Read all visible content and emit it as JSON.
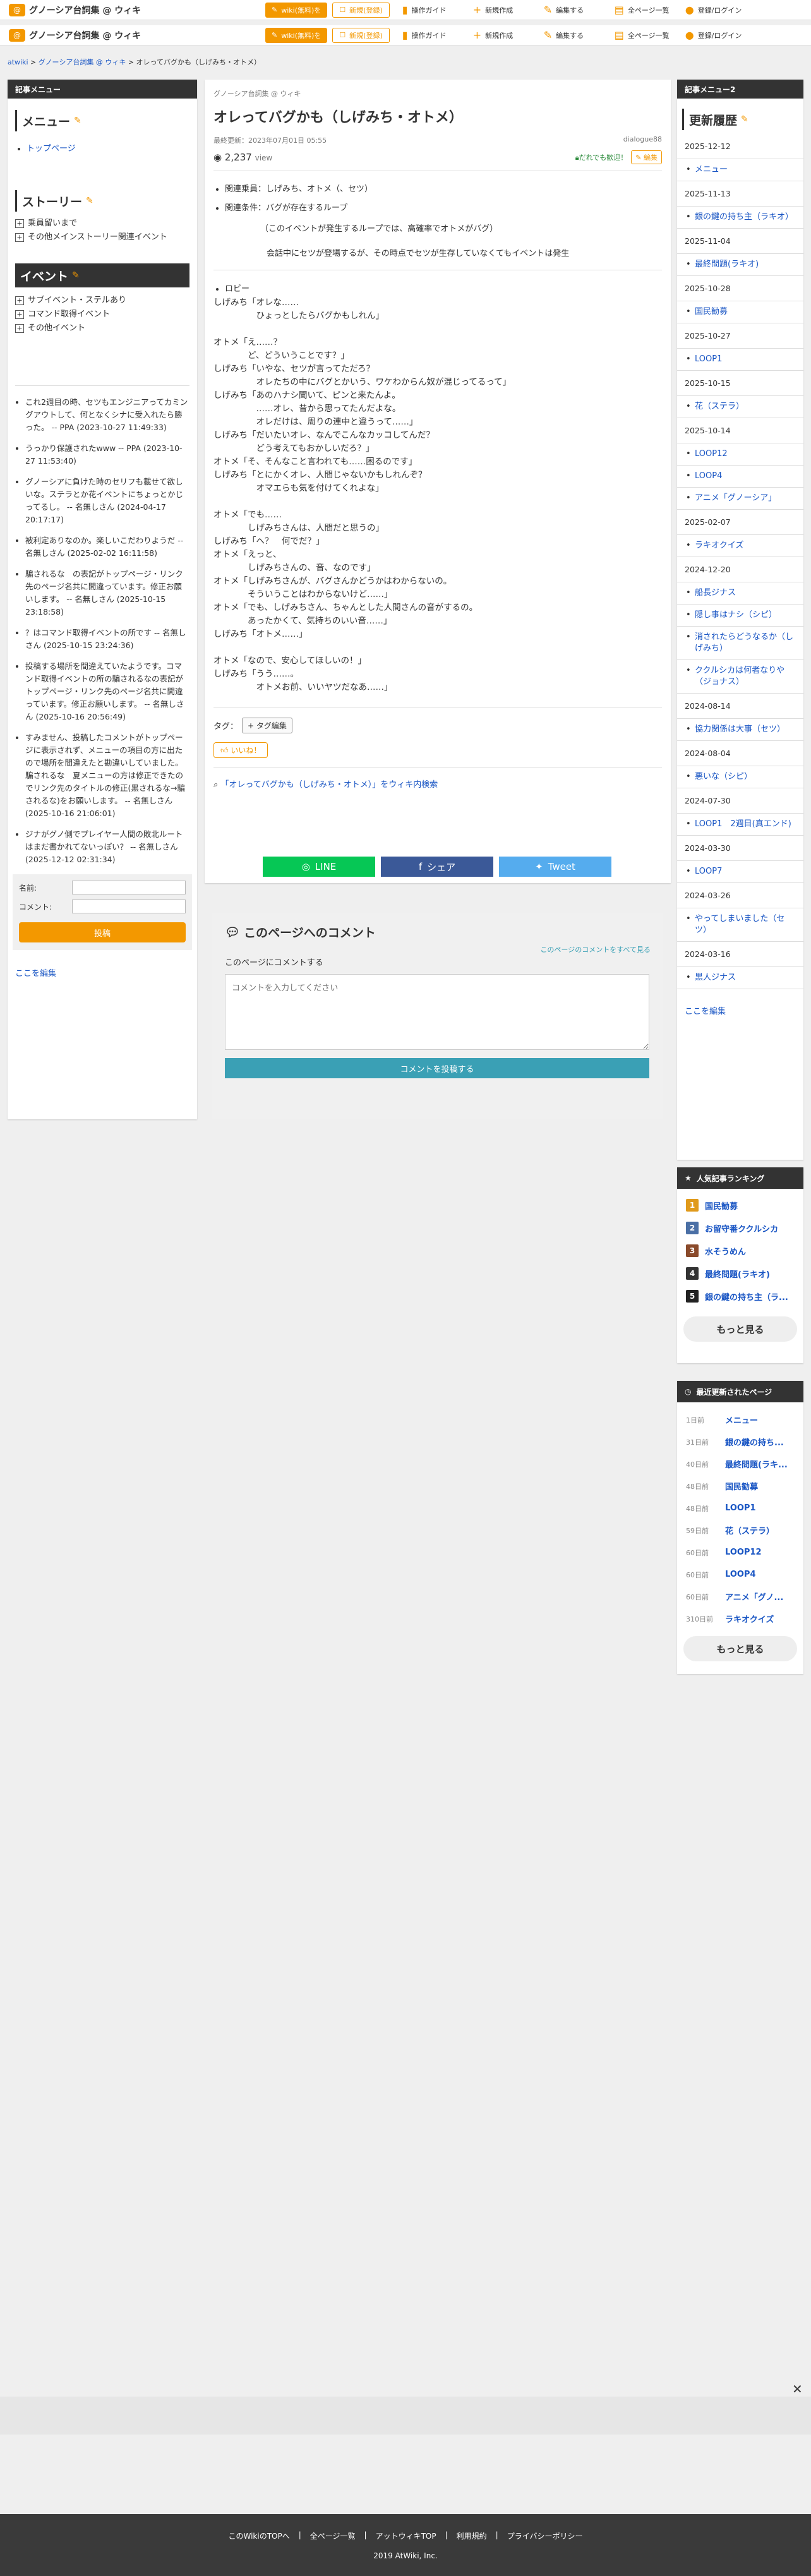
{
  "header": {
    "site_title": "グノーシア台詞集 @ ウィキ",
    "btn_wiki_create": "wiki(無料)を",
    "btn_register": "新規(登録)",
    "nav": [
      "操作ガイド",
      "新規作成",
      "編集する",
      "全ページ一覧",
      "登録/ログイン"
    ]
  },
  "breadcrumb": {
    "root": "atwiki",
    "wiki": "グノーシア台詞集 @ ウィキ",
    "page": "オレってバグかも（しげみち・オトメ）",
    "sep": ">"
  },
  "left": {
    "header": "記事メニュー",
    "menu_title": "メニュー",
    "menu_items": [
      "トップページ"
    ],
    "story_title": "ストーリー",
    "story_items": [
      "乗員留いまで",
      "その他メインストーリー関連イベント"
    ],
    "event_title": "イベント",
    "event_items": [
      "サブイベント・ステルあり",
      "コマンド取得イベント",
      "その他イベント"
    ],
    "comments": [
      "これ2週目の時、セツもエンジニアってカミングアウトして、何となくシナに受入れたら勝った。 -- PPA (2023-10-27 11:49:33)",
      "うっかり保護されたwww -- PPA (2023-10-27 11:53:40)",
      "グノーシアに負けた時のセリフも載せて欲しいな。ステラとか花イベントにちょっとかじってるし。 -- 名無しさん (2024-04-17 20:17:17)",
      "被利定ありなのか。楽しいこだわりようだ -- 名無しさん (2025-02-02 16:11:58)",
      "騙されるな　の表記がトップページ・リンク先のページ名共に間違っています。修正お願いします。 -- 名無しさん (2025-10-15 23:18:58)",
      "？はコマンド取得イベントの所です -- 名無しさん (2025-10-15 23:24:36)",
      "投稿する場所を間違えていたようです。コマンド取得イベントの所の騙されるなの表記がトップページ・リンク先のページ名共に間違っています。修正お願いします。 -- 名無しさん (2025-10-16 20:56:49)",
      "すみません、投稿したコメントがトップページに表示されず、メニューの項目の方に出たので場所を間違えたと勘違いしていました。 騙されるな　夏メニューの方は修正できたのでリンク先のタイトルの修正(黒されるな→騙されるな)をお願いします。 -- 名無しさん (2025-10-16 21:06:01)",
      "ジナがグノ側でプレイヤー人間の敗北ルートはまだ書かれてないっぽい？ -- 名無しさん (2025-12-12 02:31:34)"
    ],
    "name_label": "名前:",
    "comment_label": "コメント:",
    "post_btn": "投稿",
    "edit_link": "ここを編集"
  },
  "main": {
    "wiki_name": "グノーシア台詞集 @ ウィキ",
    "title": "オレってバグかも（しげみち・オトメ）",
    "updated": "最終更新：2023年07月01日 05:55",
    "author": "dialogue88",
    "views": "2,237",
    "views_unit": "view",
    "favorite": "だれでも歓迎！",
    "edit": "編集",
    "bullet1": "関連乗員：しげみち、オトメ（、セツ）",
    "bullet2": "関連条件：バグが存在するループ",
    "note1": "（このイベントが発生するループでは、高確率でオトメがバグ）",
    "note2": "会話中にセツが登場するが、その時点でセツが生存していなくてもイベントは発生",
    "location": "ロビー",
    "lines": [
      "しげみち「オレな……",
      "　　　　　ひょっとしたらバグかもしれん」",
      "",
      "オトメ「え……？",
      "　　　　ど、どういうことです？」",
      "しげみち「いやな、セツが言ってただろ？",
      "　　　　　オレたちの中にバグとかいう、ワケわからん奴が混じってるって」",
      "しげみち「あのハナシ聞いて、ピンと来たんよ。",
      "　　　　　……オレ、昔から思ってたんだよな。",
      "　　　　　オレだけは、周りの連中と違うって……」",
      "しげみち「だいたいオレ、なんでこんなカッコしてんだ？",
      "　　　　　どう考えてもおかしいだろ？」",
      "オトメ「そ、そんなこと言われても……困るのです」",
      "しげみち「とにかくオレ、人間じゃないかもしれんぞ？",
      "　　　　　オマエらも気を付けてくれよな」",
      "",
      "オトメ「でも……",
      "　　　　しげみちさんは、人間だと思うの」",
      "しげみち「へ？　何でだ？」",
      "オトメ「えっと、",
      "　　　　しげみちさんの、音、なのです」",
      "オトメ「しげみちさんが、バグさんかどうかはわからないの。",
      "　　　　そういうことはわからないけど……」",
      "オトメ「でも、しげみちさん、ちゃんとした人間さんの音がするの。",
      "　　　　あったかくて、気持ちのいい音……」",
      "しげみち「オトメ……」",
      "",
      "オトメ「なので、安心してほしいの！」",
      "しげみち「うう……。",
      "　　　　　オトメお前、いいヤツだなあ……」"
    ],
    "tag_label": "タグ：",
    "tag_btn": "+ タグ編集",
    "like": "いいね！",
    "search_text": "「オレってバグかも（しげみち・オトメ）」をウィキ内検索",
    "share": [
      "LINE",
      "シェア",
      "Tweet"
    ],
    "comment_title": "このページへのコメント",
    "comment_all": "このページのコメントをすべて見る",
    "comment_label": "このページにコメントする",
    "comment_placeholder": "コメントを入力してください",
    "comment_submit": "コメントを投稿する"
  },
  "right": {
    "header": "記事メニュー2",
    "history_title": "更新履歴",
    "history": [
      {
        "date": "2025-12-12",
        "items": [
          "メニュー"
        ]
      },
      {
        "date": "2025-11-13",
        "items": [
          "銀の鍵の持ち主（ラキオ）"
        ]
      },
      {
        "date": "2025-11-04",
        "items": [
          "最終問題(ラキオ)"
        ]
      },
      {
        "date": "2025-10-28",
        "items": []
      },
      {
        "date": "",
        "items": [
          "国民勧募"
        ]
      },
      {
        "date": "2025-10-27",
        "items": [
          "LOOP1"
        ]
      },
      {
        "date": "2025-10-15",
        "items": [
          "花（ステラ）"
        ]
      },
      {
        "date": "2025-10-14",
        "items": [
          "LOOP12",
          "LOOP4",
          "アニメ「グノーシア」"
        ]
      },
      {
        "date": "2025-02-07",
        "items": [
          "ラキオクイズ"
        ]
      },
      {
        "date": "2024-12-20",
        "items": [
          "船長ジナス",
          "隠し事はナシ（シピ）",
          "消されたらどうなるか（しげみち）",
          "ククルシカは何者なりや（ジョナス）"
        ]
      },
      {
        "date": "2024-08-14",
        "items": [
          "協力関係は大事（セツ）"
        ]
      },
      {
        "date": "2024-08-04",
        "items": [
          "悪いな（シピ）"
        ]
      },
      {
        "date": "2024-07-30",
        "items": [
          "LOOP1　2週目(真エンド)"
        ]
      },
      {
        "date": "2024-03-30",
        "items": [
          "LOOP7"
        ]
      },
      {
        "date": "2024-03-26",
        "items": [
          "やってしまいました（セツ）"
        ]
      },
      {
        "date": "2024-03-16",
        "items": [
          "黒人ジナス"
        ]
      }
    ],
    "edit_link": "ここを編集",
    "ranking_title": "人気記事ランキング",
    "ranking": [
      "国民勧募",
      "お留守番ククルシカ",
      "水そうめん",
      "最終問題(ラキオ)",
      "銀の鍵の持ち主（ラ..."
    ],
    "ranking_colors": [
      "#e09a1b",
      "#4a6fa5",
      "#8a4a2b",
      "#333333",
      "#222222"
    ],
    "more": "もっと見る",
    "recent_title": "最近更新されたページ",
    "recent": [
      {
        "d": "1日前",
        "t": "メニュー"
      },
      {
        "d": "31日前",
        "t": "銀の鍵の持ち..."
      },
      {
        "d": "40日前",
        "t": "最終問題(ラキ..."
      },
      {
        "d": "48日前",
        "t": "国民勧募"
      },
      {
        "d": "48日前",
        "t": "LOOP1"
      },
      {
        "d": "59日前",
        "t": "花（ステラ）"
      },
      {
        "d": "60日前",
        "t": "LOOP12"
      },
      {
        "d": "60日前",
        "t": "LOOP4"
      },
      {
        "d": "60日前",
        "t": "アニメ「グノ..."
      },
      {
        "d": "310日前",
        "t": "ラキオクイズ"
      }
    ]
  },
  "footer": {
    "links": [
      "このWikiのTOPへ",
      "全ページ一覧",
      "アットウィキTOP",
      "利用規約",
      "プライバシーポリシー"
    ],
    "copyright": "2019 AtWiki, Inc."
  }
}
